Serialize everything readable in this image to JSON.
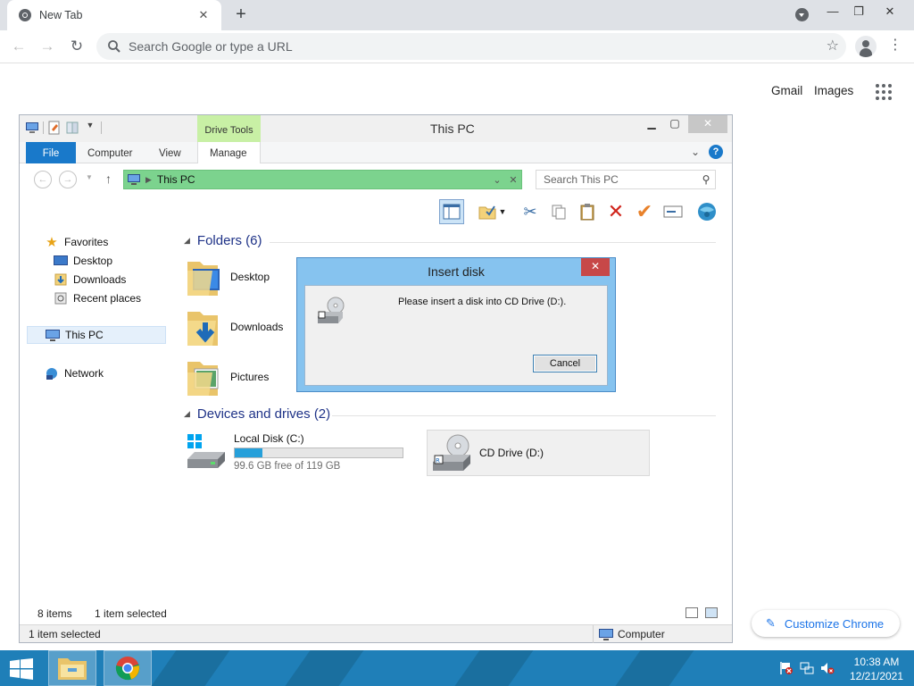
{
  "browser": {
    "tab_title": "New Tab",
    "tab_close": "✕",
    "new_tab": "+",
    "omnibox_placeholder": "Search Google or type a URL",
    "links": {
      "gmail": "Gmail",
      "images": "Images"
    },
    "customize_label": "Customize Chrome"
  },
  "explorer": {
    "title": "This PC",
    "contextual_tab": "Drive Tools",
    "ribbon_tabs": {
      "file": "File",
      "computer": "Computer",
      "view": "View",
      "manage": "Manage"
    },
    "address": "This PC",
    "search_placeholder": "Search This PC",
    "nav": {
      "favorites": "Favorites",
      "desktop": "Desktop",
      "downloads": "Downloads",
      "recent": "Recent places",
      "this_pc": "This PC",
      "network": "Network"
    },
    "folders_header": "Folders (6)",
    "folders": [
      "Desktop",
      "Downloads",
      "Pictures"
    ],
    "devices_header": "Devices and drives (2)",
    "local_disk": {
      "label": "Local Disk (C:)",
      "free_text": "99.6 GB free of 119 GB",
      "used_fraction": 0.163
    },
    "cd_drive": {
      "label": "CD Drive (D:)"
    },
    "status_items": "8 items",
    "status_selected": "1 item selected",
    "statusbar_left": "1 item selected",
    "statusbar_right": "Computer"
  },
  "dialog": {
    "title": "Insert disk",
    "close": "✕",
    "message": "Please insert a disk into CD Drive (D:).",
    "cancel": "Cancel"
  },
  "taskbar": {
    "time": "10:38 AM",
    "date": "12/21/2021"
  },
  "colors": {
    "file_tab": "#1979ca",
    "address_bar": "#7cd38e",
    "drive_tools": "#c8f0a5",
    "taskbar": "#1f7fb8",
    "dialog_frame": "#86c3ef",
    "dialog_close": "#c74848",
    "accent_link": "#1a73e8"
  }
}
